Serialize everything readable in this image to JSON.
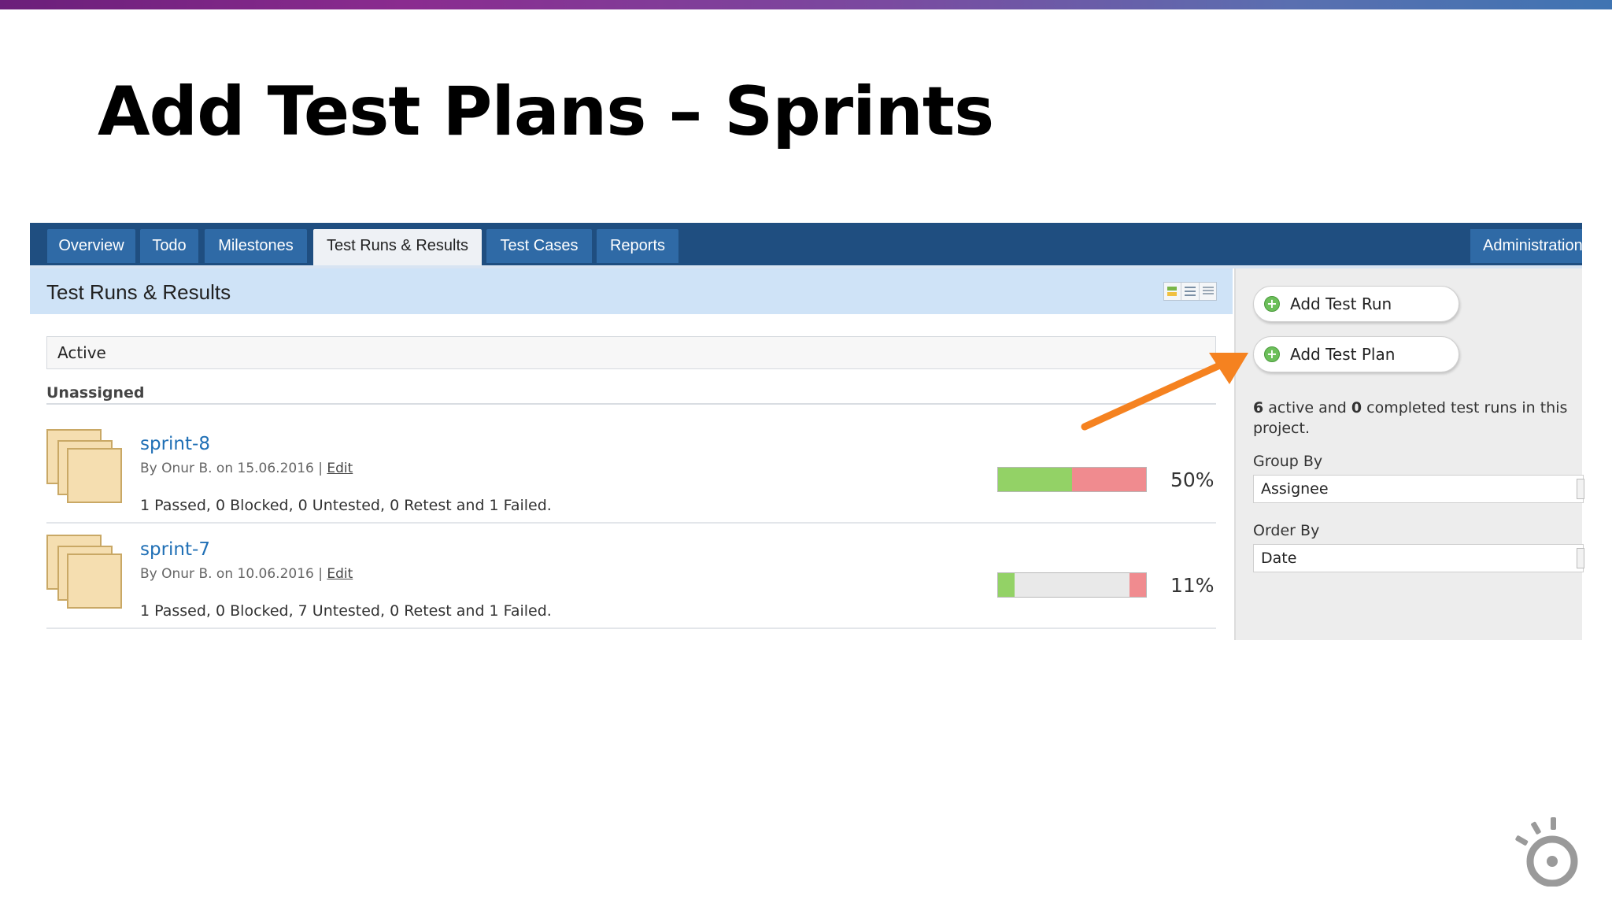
{
  "slide": {
    "title": "Add Test Plans – Sprints"
  },
  "nav": {
    "tabs": [
      {
        "label": "Overview"
      },
      {
        "label": "Todo"
      },
      {
        "label": "Milestones"
      },
      {
        "label": "Test Runs & Results"
      },
      {
        "label": "Test Cases"
      },
      {
        "label": "Reports"
      }
    ],
    "active_tab": "Test Runs & Results",
    "admin_label": "Administration"
  },
  "main": {
    "heading": "Test Runs & Results",
    "filter": "Active",
    "group_label": "Unassigned",
    "runs": [
      {
        "name": "sprint-8",
        "meta": "By Onur B. on 15.06.2016 |",
        "edit_label": "Edit",
        "stats": "1 Passed, 0 Blocked, 0 Untested, 0 Retest and 1 Failed.",
        "percent": "50%",
        "passed_fraction": 0.5,
        "failed_fraction": 0.5
      },
      {
        "name": "sprint-7",
        "meta": "By Onur B. on 10.06.2016 |",
        "edit_label": "Edit",
        "stats": "1 Passed, 0 Blocked, 7 Untested, 0 Retest and 1 Failed.",
        "percent": "11%",
        "passed_fraction": 0.11,
        "failed_fraction": 0.11
      }
    ]
  },
  "sidebar": {
    "add_run_label": "Add Test Run",
    "add_plan_label": "Add Test Plan",
    "active_count": "6",
    "completed_count": "0",
    "summary_part1": " active and ",
    "summary_part2": " completed test runs in this project.",
    "group_by_label": "Group By",
    "group_by_value": "Assignee",
    "order_by_label": "Order By",
    "order_by_value": "Date"
  },
  "colors": {
    "nav_bg": "#1f4e80",
    "tab_bg": "#2f6aa6",
    "header_band": "#cfe3f7",
    "passed": "#93d266",
    "failed": "#f08b8f",
    "arrow": "#f58220",
    "link": "#1f6fb5"
  },
  "icons": [
    "folder-stack-icon",
    "add-circle-icon",
    "view-toggle-icon",
    "annotation-arrow-icon",
    "brand-logo-icon"
  ]
}
